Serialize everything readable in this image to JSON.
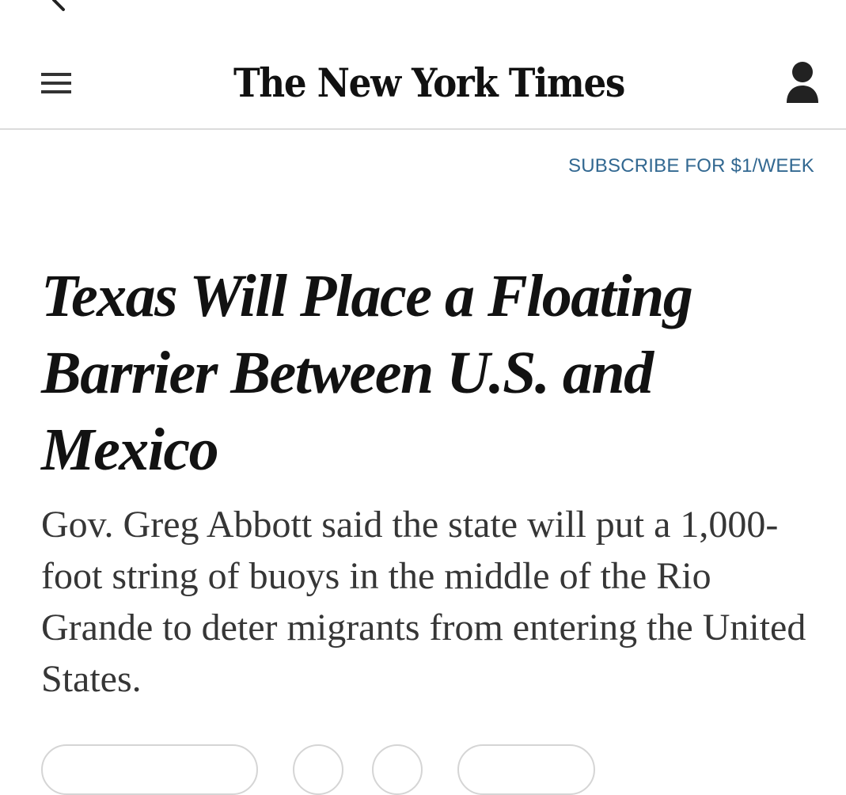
{
  "icons": {
    "back": "chevron-left-icon",
    "menu": "hamburger-menu-icon",
    "account": "user-account-icon"
  },
  "masthead": {
    "logo_text": "The New York Times"
  },
  "subscribe": {
    "label": "SUBSCRIBE FOR $1/WEEK",
    "color": "#326891"
  },
  "article": {
    "headline": "Texas Will Place a Floating Barrier Between U.S. and Mexico",
    "summary": "Gov. Greg Abbott said the state will put a 1,000-foot string of buoys in the middle of the Rio Grande to deter migrants from entering the United States."
  }
}
